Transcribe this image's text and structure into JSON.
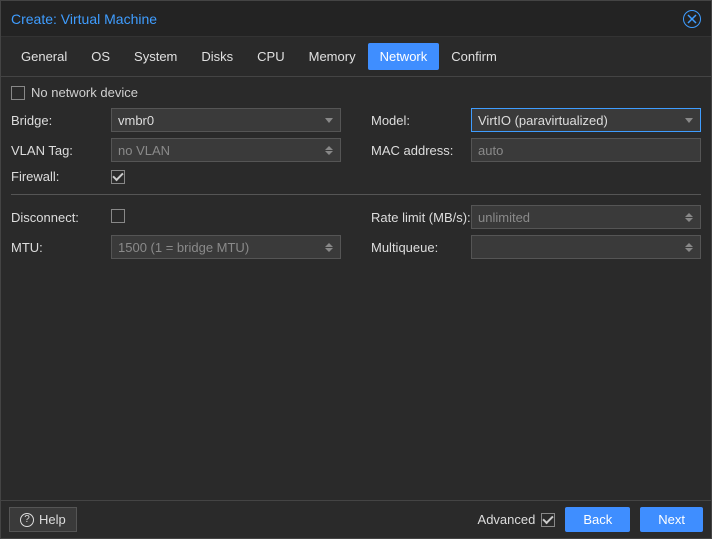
{
  "title": "Create: Virtual Machine",
  "tabs": [
    "General",
    "OS",
    "System",
    "Disks",
    "CPU",
    "Memory",
    "Network",
    "Confirm"
  ],
  "activeTab": "Network",
  "noNetLabel": "No network device",
  "left": {
    "bridge": {
      "label": "Bridge:",
      "value": "vmbr0"
    },
    "vlan": {
      "label": "VLAN Tag:",
      "placeholder": "no VLAN"
    },
    "firewall": {
      "label": "Firewall:"
    }
  },
  "right": {
    "model": {
      "label": "Model:",
      "value": "VirtIO (paravirtualized)"
    },
    "mac": {
      "label": "MAC address:",
      "placeholder": "auto"
    }
  },
  "adv": {
    "disconnect": {
      "label": "Disconnect:"
    },
    "mtu": {
      "label": "MTU:",
      "placeholder": "1500 (1 = bridge MTU)"
    },
    "rate": {
      "label": "Rate limit (MB/s):",
      "placeholder": "unlimited"
    },
    "multiqueue": {
      "label": "Multiqueue:"
    }
  },
  "footer": {
    "help": "Help",
    "advanced": "Advanced",
    "back": "Back",
    "next": "Next"
  }
}
